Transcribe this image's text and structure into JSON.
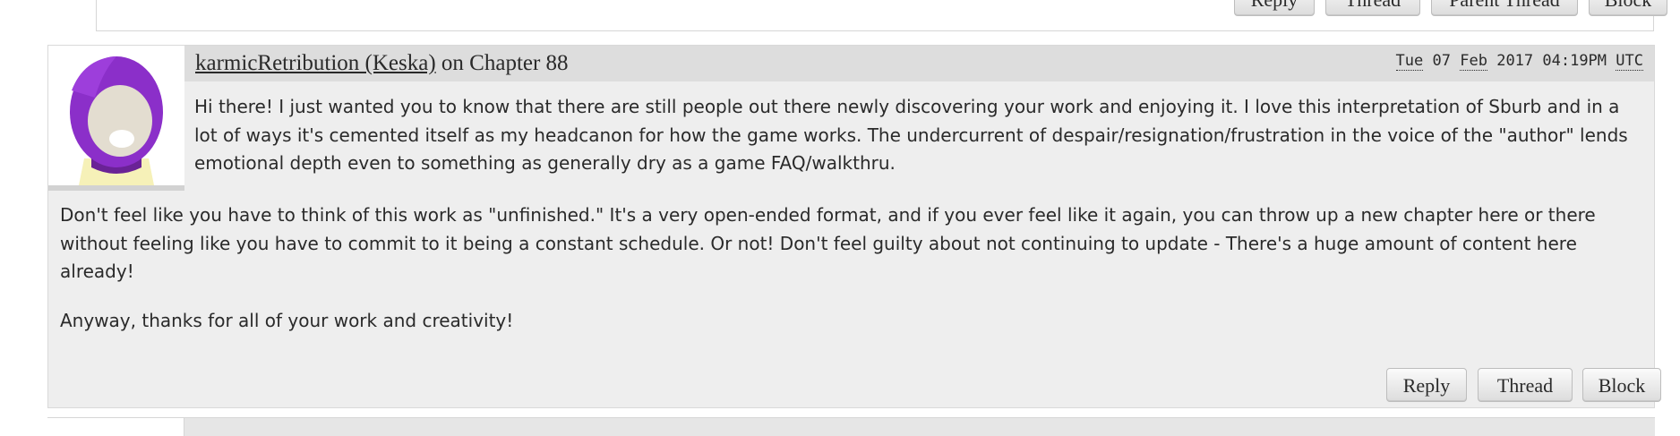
{
  "previous_comment": {
    "actions": [
      "Reply",
      "Thread",
      "Parent Thread",
      "Block"
    ]
  },
  "comment": {
    "author": "karmicRetribution (Keska)",
    "on_label": "on Chapter 88",
    "timestamp": {
      "day": "Tue",
      "date": "07",
      "month": "Feb",
      "year_time": "2017 04:19PM",
      "zone": "UTC"
    },
    "paragraphs": [
      "Hi there! I just wanted you to know that there are still people out there newly discovering your work and enjoying it. I love this interpretation of Sburb and in a lot of ways it's cemented itself as my headcanon for how the game works. The undercurrent of despair/resignation/frustration in the voice of the \"author\" lends emotional depth even to something as generally dry as a game FAQ/walkthru.",
      "Don't feel like you have to think of this work as \"unfinished.\" It's a very open-ended format, and if you ever feel like it again, you can throw up a new chapter here or there without feeling like you have to commit to it being a constant schedule. Or not! Don't feel guilty about not continuing to update - There's a huge amount of content here already!",
      "Anyway, thanks for all of your work and creativity!"
    ],
    "actions": [
      "Reply",
      "Thread",
      "Block"
    ],
    "avatar_colors": {
      "hood": "#8b2fc9",
      "face": "#e3ddd0",
      "shirt": "#f6f1b8"
    }
  }
}
